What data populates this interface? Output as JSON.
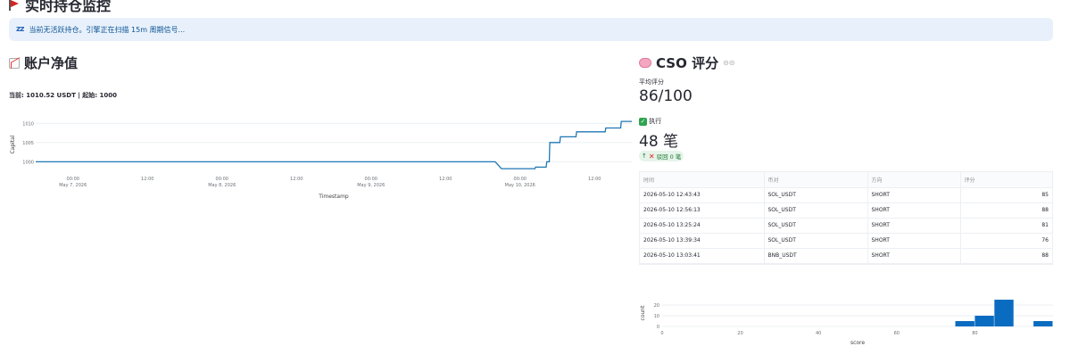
{
  "page": {
    "title": "实时持仓监控",
    "banner": "当前无活跃持仓。引擎正在扫描 15m 周期信号..."
  },
  "equity": {
    "title": "账户净值",
    "capital_text": "当前: 1010.52 USDT | 起始: 1000"
  },
  "cso": {
    "title": "CSO 评分",
    "avg_label": "平均评分",
    "avg_value": "86/100",
    "exec_label": "执行",
    "exec_value": "48 笔",
    "delta_text": "驳回 0 笔",
    "table": {
      "headers": [
        "时间",
        "币对",
        "方向",
        "评分"
      ],
      "rows": [
        [
          "2026-05-10 12:43:43",
          "SOL_USDT",
          "SHORT",
          "85"
        ],
        [
          "2026-05-10 12:56:13",
          "SOL_USDT",
          "SHORT",
          "88"
        ],
        [
          "2026-05-10 13:25:24",
          "SOL_USDT",
          "SHORT",
          "81"
        ],
        [
          "2026-05-10 13:39:34",
          "SOL_USDT",
          "SHORT",
          "76"
        ],
        [
          "2026-05-10 13:03:41",
          "BNB_USDT",
          "SHORT",
          "88"
        ]
      ]
    }
  },
  "colors": {
    "accent": "#1f77b4",
    "bar": "#0a6cc0",
    "banner_bg": "#e8f1fb",
    "banner_text": "#0b5394"
  },
  "chart_data": [
    {
      "type": "line",
      "xlabel": "Timestamp",
      "ylabel": "Capital",
      "ylim": [
        998,
        1011
      ],
      "y_ticks": [
        1000,
        1005,
        1010
      ],
      "x_tick_labels": [
        [
          "00:00",
          "May 7, 2026"
        ],
        [
          "12:00",
          ""
        ],
        [
          "00:00",
          "May 8, 2026"
        ],
        [
          "12:00",
          ""
        ],
        [
          "00:00",
          "May 9, 2026"
        ],
        [
          "12:00",
          ""
        ],
        [
          "00:00",
          "May 10, 2026"
        ],
        [
          "12:00",
          ""
        ]
      ],
      "x_tick_hours": [
        0,
        12,
        24,
        36,
        48,
        60,
        72,
        84
      ],
      "xlim_hours": [
        -6,
        90
      ],
      "points": [
        [
          -6,
          1000
        ],
        [
          68,
          1000
        ],
        [
          69,
          998.2
        ],
        [
          74.4,
          998.2
        ],
        [
          74.5,
          998.6
        ],
        [
          76.2,
          998.6
        ],
        [
          76.3,
          1000
        ],
        [
          76.7,
          1000
        ],
        [
          76.8,
          1005
        ],
        [
          78.4,
          1005
        ],
        [
          78.5,
          1006.5
        ],
        [
          81,
          1006.5
        ],
        [
          81.1,
          1007.8
        ],
        [
          85.7,
          1007.8
        ],
        [
          85.8,
          1008.8
        ],
        [
          88.2,
          1008.8
        ],
        [
          88.3,
          1010.52
        ],
        [
          90,
          1010.52
        ]
      ]
    },
    {
      "type": "bar",
      "xlabel": "score",
      "ylabel": "count",
      "xlim": [
        0,
        100
      ],
      "ylim": [
        0,
        25
      ],
      "x_ticks": [
        0,
        20,
        40,
        60,
        80
      ],
      "y_ticks": [
        0,
        10,
        20
      ],
      "bins": [
        {
          "x0": 75,
          "x1": 80,
          "count": 5
        },
        {
          "x0": 80,
          "x1": 85,
          "count": 10
        },
        {
          "x0": 85,
          "x1": 90,
          "count": 25
        },
        {
          "x0": 95,
          "x1": 100,
          "count": 5
        }
      ]
    }
  ]
}
